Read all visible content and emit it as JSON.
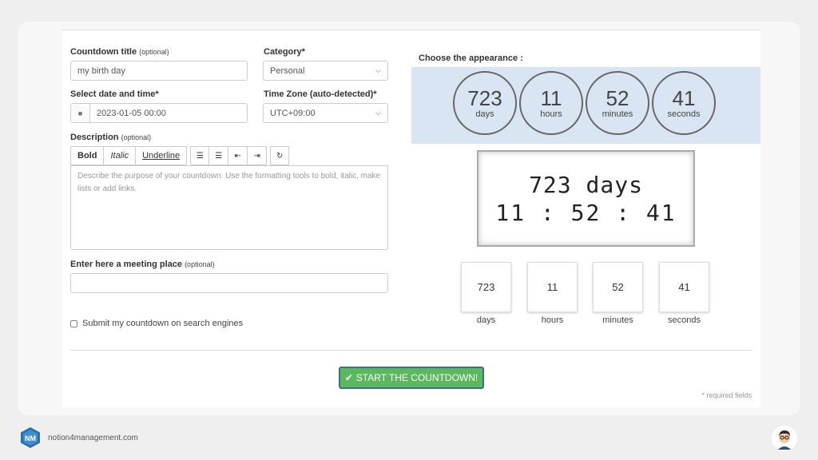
{
  "form": {
    "countdown_title": {
      "label": "Countdown title",
      "optional": "(optional)",
      "value": "my birth day"
    },
    "category": {
      "label": "Category*",
      "value": "Personal"
    },
    "datetime": {
      "label": "Select date and time*",
      "value": "2023-01-05 00:00"
    },
    "timezone": {
      "label": "Time Zone (auto-detected)*",
      "value": "UTC+09:00"
    },
    "description": {
      "label": "Description",
      "optional": "(optional)",
      "placeholder": "Describe the purpose of your countdown. Use the formatting tools to bold, italic, make lists or add links."
    },
    "toolbar": {
      "bold": "Bold",
      "italic": "Italic",
      "underline": "Underline"
    },
    "meeting_place": {
      "label": "Enter here a meeting place",
      "optional": "(optional)",
      "value": ""
    },
    "submit_search": "Submit my countdown on search engines",
    "start_button": "START THE COUNTDOWN!",
    "required_note": "* required fields"
  },
  "appearance": {
    "label": "Choose the appearance :",
    "circles": [
      {
        "value": "723",
        "unit": "days"
      },
      {
        "value": "11",
        "unit": "hours"
      },
      {
        "value": "52",
        "unit": "minutes"
      },
      {
        "value": "41",
        "unit": "seconds"
      }
    ],
    "digital": {
      "line1": "723 days",
      "line2": "11 : 52 : 41"
    },
    "boxes": [
      {
        "value": "723",
        "unit": "days"
      },
      {
        "value": "11",
        "unit": "hours"
      },
      {
        "value": "52",
        "unit": "minutes"
      },
      {
        "value": "41",
        "unit": "seconds"
      }
    ]
  },
  "footer": {
    "site": "notion4management.com"
  },
  "colors": {
    "accent": "#5cb85c",
    "appearance_bg": "#d9e5f3"
  }
}
